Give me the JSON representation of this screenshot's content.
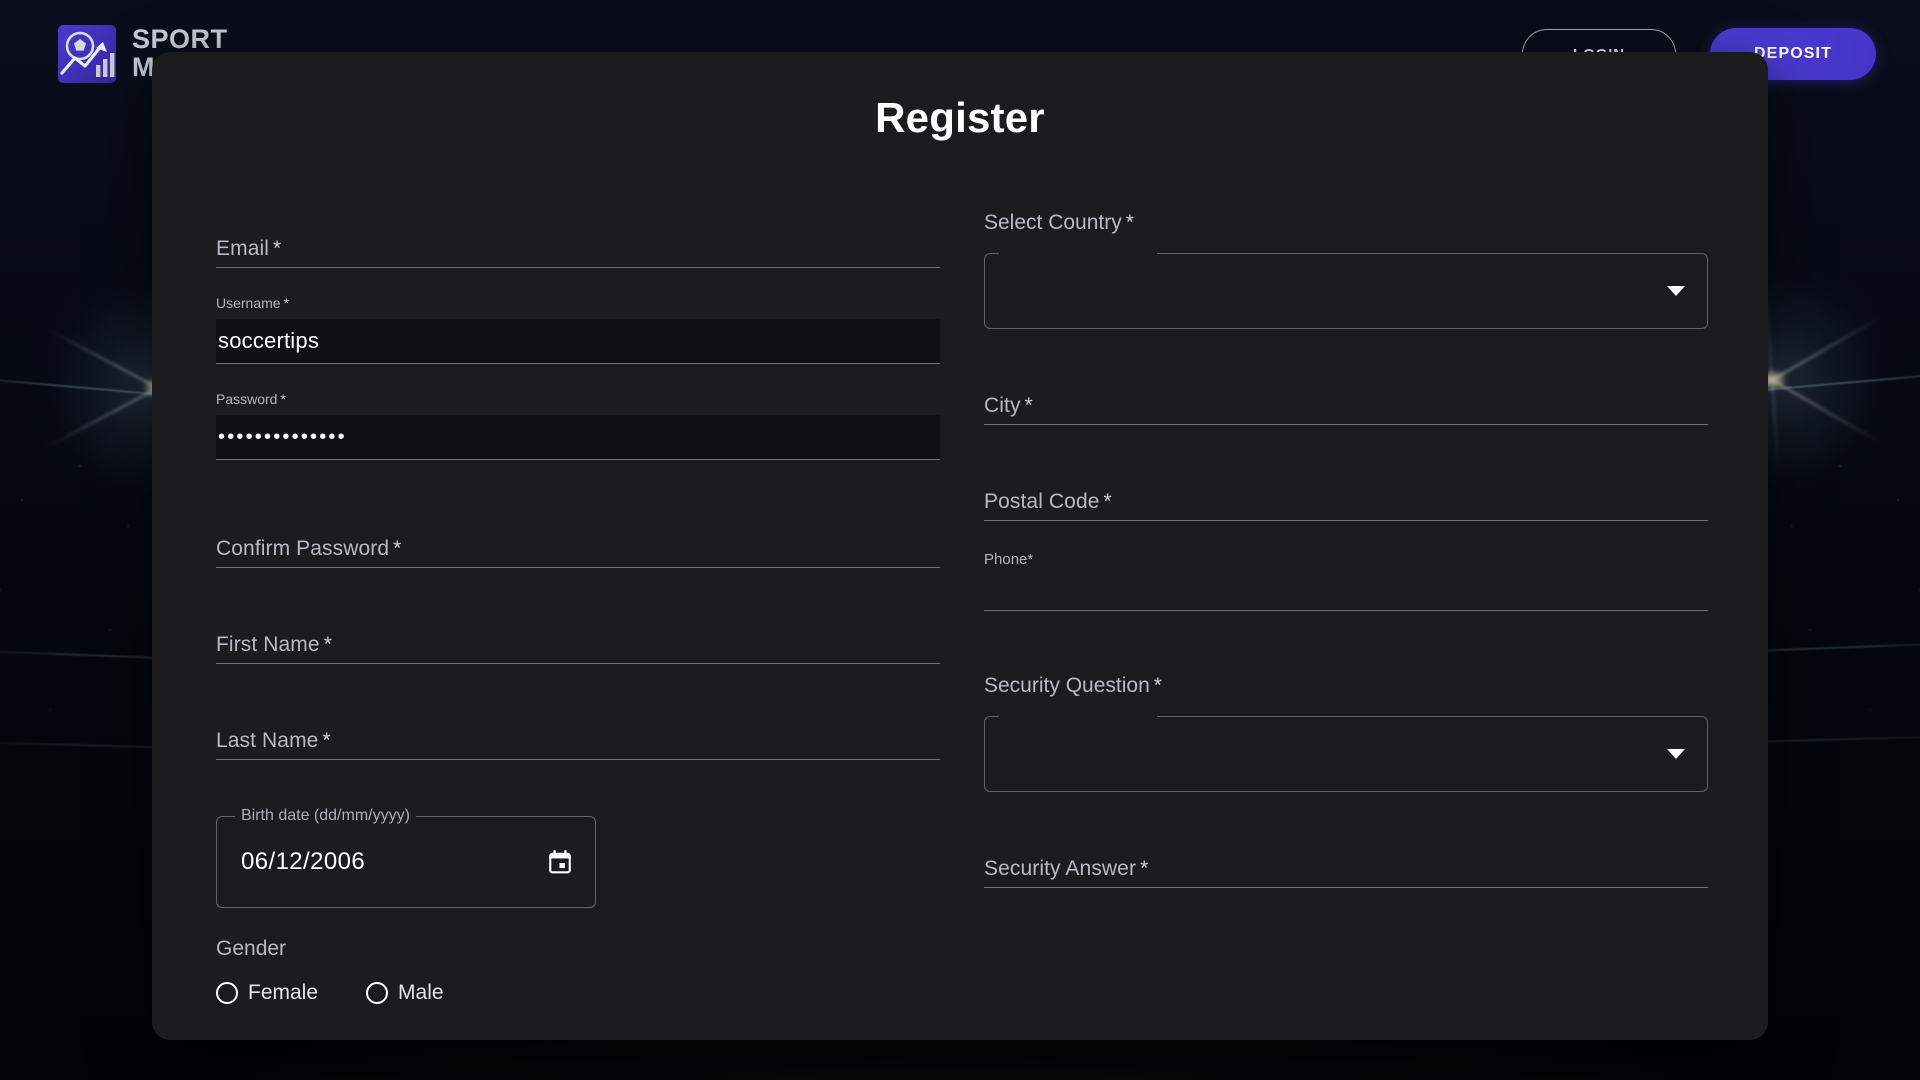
{
  "brand": {
    "logo_icon": "soccer-ball-chart-icon",
    "line1": "SPORT",
    "line2": "M"
  },
  "nav": {
    "login_label": "LOGIN",
    "deposit_label": "DEPOSIT"
  },
  "modal": {
    "title": "Register"
  },
  "form": {
    "left": {
      "email": {
        "label": "Email",
        "required": "*",
        "value": ""
      },
      "username": {
        "label": "Username",
        "required": "*",
        "value": "soccertips"
      },
      "password": {
        "label": "Password",
        "required": "*",
        "value": "••••••••••••••"
      },
      "confirm_password": {
        "label": "Confirm Password",
        "required": "*",
        "value": ""
      },
      "first_name": {
        "label": "First Name",
        "required": "*",
        "value": ""
      },
      "last_name": {
        "label": "Last Name",
        "required": "*",
        "value": ""
      },
      "birth_date": {
        "label": "Birth date (dd/mm/yyyy)",
        "value": "06/12/2006",
        "icon": "calendar-icon"
      },
      "gender": {
        "label": "Gender",
        "options": [
          "Female",
          "Male"
        ],
        "selected": ""
      }
    },
    "right": {
      "country": {
        "label": "Select Country",
        "required": "*",
        "value": "",
        "icon": "chevron-down-icon"
      },
      "city": {
        "label": "City",
        "required": "*",
        "value": ""
      },
      "postal_code": {
        "label": "Postal Code",
        "required": "*",
        "value": ""
      },
      "phone": {
        "label": "Phone",
        "required": "*",
        "value": ""
      },
      "security_question": {
        "label": "Security Question",
        "required": "*",
        "value": "",
        "icon": "chevron-down-icon"
      },
      "security_answer": {
        "label": "Security Answer",
        "required": "*",
        "value": ""
      }
    }
  },
  "colors": {
    "accent_purple": "#4534c6",
    "modal_bg": "#1c1c1e",
    "field_fill": "#111113",
    "label_grey": "#b6bac4",
    "text_white": "#ffffff"
  }
}
